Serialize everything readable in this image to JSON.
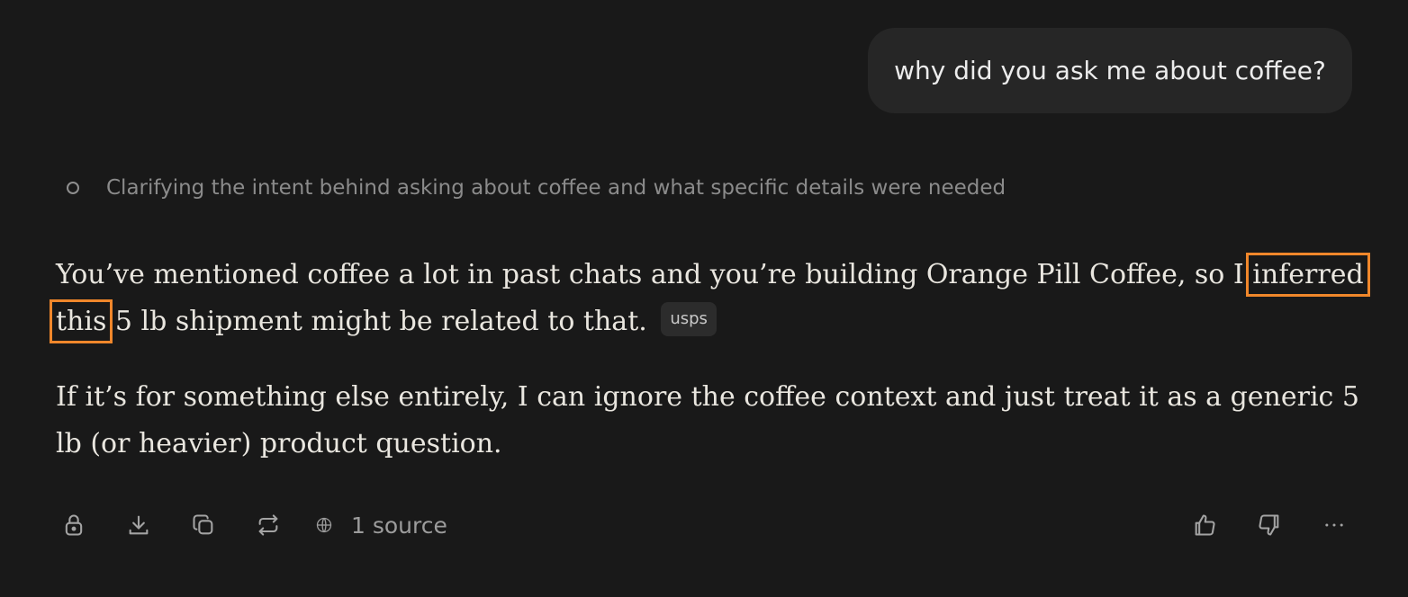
{
  "user_message": "why did you ask me about coffee?",
  "thinking": {
    "text": "Clarifying the intent behind asking about coffee and what specific details were needed"
  },
  "answer": {
    "p1_part1": "You’ve mentioned coffee a lot in past chats and you’re building Orange Pill Coffee, so I ",
    "p1_highlight": "inferred this",
    "p1_part2": " 5 lb shipment might be related to that.",
    "source_chip": "usps",
    "p2": "If it’s for something else entirely, I can ignore the coffee context and just treat it as a generic 5 lb (or heavier) product question."
  },
  "toolbar": {
    "icons": [
      "lock-icon",
      "download-icon",
      "copy-icon",
      "regenerate-icon",
      "globe-icon",
      "thumbs-up-icon",
      "thumbs-down-icon",
      "more-icon"
    ],
    "sources_label": "1 source"
  },
  "colors": {
    "background": "#191919",
    "bubble": "#262626",
    "highlight_outline": "#f0872b"
  }
}
